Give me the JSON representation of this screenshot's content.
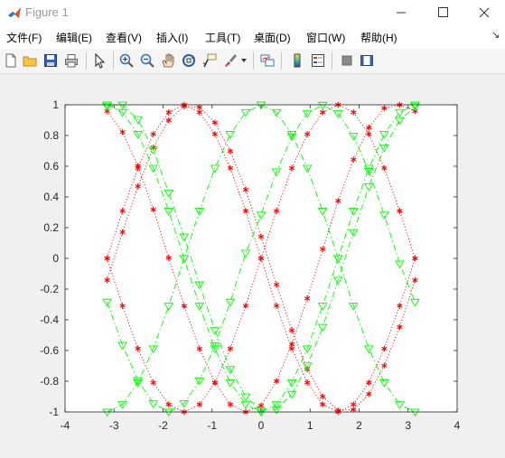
{
  "window": {
    "title": "Figure 1",
    "min_symbol": "—",
    "max_symbol": "☐",
    "close_symbol": "✕"
  },
  "menu": {
    "items": [
      "文件(F)",
      "编辑(E)",
      "查看(V)",
      "插入(I)",
      "工具(T)",
      "桌面(D)",
      "窗口(W)",
      "帮助(H)"
    ],
    "more_symbol": "↘"
  },
  "toolbar": {
    "icons": [
      "new-figure-icon",
      "open-file-icon",
      "save-icon",
      "print-icon",
      "select-arrow-icon",
      "zoom-in-icon",
      "zoom-out-icon",
      "pan-hand-icon",
      "rotate-3d-icon",
      "data-cursor-icon",
      "brush-icon",
      "link-plot-icon",
      "colorbar-icon",
      "legend-icon",
      "hide-plot-tools-icon",
      "show-plot-tools-icon"
    ]
  },
  "colors": {
    "red_series": "#ff0000",
    "green_series": "#00ff00",
    "axes_bg": "#ffffff",
    "figure_bg": "#f0f0f0"
  },
  "chart_data": {
    "type": "line",
    "title": "",
    "xlabel": "",
    "ylabel": "",
    "xlim": [
      -4,
      4
    ],
    "ylim": [
      -1,
      1
    ],
    "xticks": [
      -4,
      -3,
      -2,
      -1,
      0,
      1,
      2,
      3,
      4
    ],
    "yticks": [
      -1,
      -0.8,
      -0.6,
      -0.4,
      -0.2,
      0,
      0.2,
      0.4,
      0.6,
      0.8,
      1
    ],
    "xtick_labels": [
      "-4",
      "-3",
      "-2",
      "-1",
      "0",
      "1",
      "2",
      "3",
      "4"
    ],
    "ytick_labels": [
      "-1",
      "-0.8",
      "-0.6",
      "-0.4",
      "-0.2",
      "0",
      "0.2",
      "0.4",
      "0.6",
      "0.8",
      "1"
    ],
    "grid": false,
    "x": [
      -3.1416,
      -2.8274,
      -2.5133,
      -2.1991,
      -1.885,
      -1.5708,
      -1.2566,
      -0.9425,
      -0.6283,
      -0.3142,
      0,
      0.3142,
      0.6283,
      0.9425,
      1.2566,
      1.5708,
      1.885,
      2.1991,
      2.5133,
      2.8274,
      3.1416
    ],
    "series": [
      {
        "style": "red dotted line, asterisk markers",
        "color": "#ff0000",
        "line": "dotted",
        "marker": "asterisk",
        "values": [
          0,
          -0.309,
          -0.5878,
          -0.809,
          -0.9511,
          -1,
          -0.9511,
          -0.809,
          -0.5878,
          -0.309,
          0,
          0.309,
          0.5878,
          0.809,
          0.9511,
          1,
          0.9511,
          0.809,
          0.5878,
          0.309,
          0
        ]
      },
      {
        "style": "red dotted line, asterisk markers",
        "color": "#ff0000",
        "line": "dotted",
        "marker": "asterisk",
        "values": [
          0,
          0.309,
          0.5878,
          0.809,
          0.9511,
          1,
          0.9511,
          0.809,
          0.5878,
          0.309,
          0,
          -0.309,
          -0.5878,
          -0.809,
          -0.9511,
          -1,
          -0.9511,
          -0.809,
          -0.5878,
          -0.309,
          0
        ]
      },
      {
        "style": "red dotted line, asterisk markers",
        "color": "#ff0000",
        "line": "dotted",
        "marker": "asterisk",
        "values": [
          -0.1411,
          0.1705,
          0.4689,
          0.7215,
          0.8997,
          0.99,
          0.9844,
          0.8838,
          0.6987,
          0.4472,
          0.1411,
          -0.1705,
          -0.4689,
          -0.7215,
          -0.8997,
          -0.99,
          -0.9844,
          -0.8838,
          -0.6987,
          -0.4472,
          -0.1411
        ]
      },
      {
        "style": "red dotted line, asterisk markers",
        "color": "#ff0000",
        "line": "dotted",
        "marker": "asterisk",
        "values": [
          0.9589,
          0.8227,
          0.6014,
          0.318,
          0.0037,
          -0.3093,
          -0.588,
          -0.8091,
          -0.9511,
          -1.0,
          -0.9589,
          -0.7993,
          -0.5587,
          -0.2608,
          0.06,
          0.3739,
          0.6433,
          0.8515,
          0.9787,
          0.9993,
          0.9589
        ]
      },
      {
        "style": "green dash-dot line, triangle markers",
        "color": "#00ff00",
        "line": "dashdot",
        "marker": "triangle-down",
        "values": [
          -1,
          -0.9511,
          -0.809,
          -0.5878,
          -0.309,
          0,
          0.309,
          0.5878,
          0.809,
          0.9511,
          1,
          0.9511,
          0.809,
          0.5878,
          0.309,
          0,
          -0.309,
          -0.5878,
          -0.809,
          -0.9511,
          -1
        ]
      },
      {
        "style": "green dash-dot line, triangle markers",
        "color": "#00ff00",
        "line": "dashdot",
        "marker": "triangle-down",
        "values": [
          1,
          0.9511,
          0.809,
          0.5878,
          0.309,
          0,
          -0.309,
          -0.5878,
          -0.809,
          -0.9511,
          -1,
          -0.9511,
          -0.809,
          -0.5878,
          -0.309,
          0,
          0.309,
          0.5878,
          0.809,
          0.9511,
          1
        ]
      },
      {
        "style": "green dash-dot line, triangle markers",
        "color": "#00ff00",
        "line": "dashdot",
        "marker": "triangle-down",
        "values": [
          -0.2837,
          -0.5649,
          -0.7937,
          -0.9451,
          -0.9986,
          -0.9437,
          -0.7966,
          -0.568,
          -0.2837,
          0.0348,
          0.2837,
          0.5649,
          0.7937,
          0.9451,
          0.9986,
          0.9437,
          0.7966,
          0.568,
          0.2837,
          -0.0348,
          -0.2837
        ]
      },
      {
        "style": "green dash-dot line, triangle markers",
        "color": "#00ff00",
        "line": "dashdot",
        "marker": "triangle-down",
        "values": [
          0.99,
          0.9999,
          0.9058,
          0.7062,
          0.4279,
          0.1411,
          -0.1705,
          -0.4689,
          -0.7215,
          -0.8997,
          -0.99,
          -0.9844,
          -0.8838,
          -0.6987,
          -0.4472,
          -0.1411,
          0.1705,
          0.4689,
          0.7215,
          0.8997,
          0.99
        ]
      }
    ]
  }
}
